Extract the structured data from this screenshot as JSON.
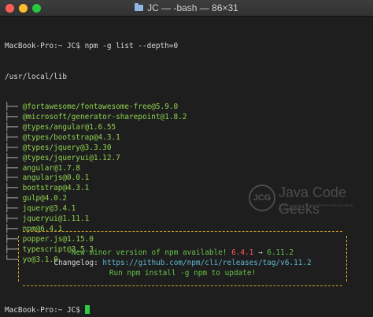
{
  "window": {
    "title": "JC — -bash — 86×31",
    "icon": "folder-icon"
  },
  "terminal": {
    "prompt": "MacBook-Pro:~ JC$ npm -g list --depth=0",
    "root": "/usr/local/lib",
    "packages": [
      {
        "tree": "├── ",
        "name": "@fortawesome/fontawesome-free@5.9.0"
      },
      {
        "tree": "├── ",
        "name": "@microsoft/generator-sharepoint@1.8.2"
      },
      {
        "tree": "├── ",
        "name": "@types/angular@1.6.55"
      },
      {
        "tree": "├── ",
        "name": "@types/bootstrap@4.3.1"
      },
      {
        "tree": "├── ",
        "name": "@types/jquery@3.3.30"
      },
      {
        "tree": "├── ",
        "name": "@types/jqueryui@1.12.7"
      },
      {
        "tree": "├── ",
        "name": "angular@1.7.8"
      },
      {
        "tree": "├── ",
        "name": "angularjs@0.0.1"
      },
      {
        "tree": "├── ",
        "name": "bootstrap@4.3.1"
      },
      {
        "tree": "├── ",
        "name": "gulp@4.0.2"
      },
      {
        "tree": "├── ",
        "name": "jquery@3.4.1"
      },
      {
        "tree": "├── ",
        "name": "jqueryui@1.11.1"
      },
      {
        "tree": "├── ",
        "name": "npm@6.4.1"
      },
      {
        "tree": "├── ",
        "name": "popper.js@1.15.0"
      },
      {
        "tree": "├── ",
        "name": "typescript@3.5.3"
      },
      {
        "tree": "└── ",
        "name": "yo@3.1.0"
      }
    ],
    "update_box": {
      "notice": "New minor version of npm available! ",
      "old_version": "6.4.1",
      "arrow": " → ",
      "new_version": "6.11.2",
      "changelog_label": "Changelog: ",
      "changelog_url": "https://github.com/npm/cli/releases/tag/v6.11.2",
      "run_hint": "Run npm install -g npm to update!"
    },
    "final_prompt": "MacBook-Pro:~ JC$ "
  },
  "watermark": {
    "logo_text": "JCG",
    "name": "Java Code Geeks",
    "tagline": "JAVA 2 JAVA DEVELOPERS RESOURCE CENTER"
  },
  "colors": {
    "background": "#1e1e1e",
    "package_green": "#8fd14f",
    "box_border": "#c9a227",
    "old_version_red": "#ff5a5a",
    "url_cyan": "#5fb7d0",
    "cursor_green": "#2ecc40"
  }
}
